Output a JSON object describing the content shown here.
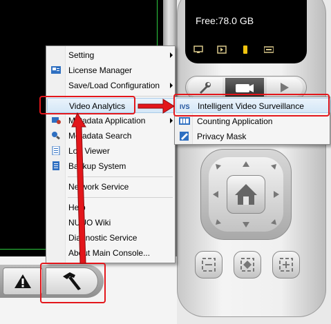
{
  "storage": {
    "free_label": "Free:78.0 GB"
  },
  "screen_icons": [
    "monitor-icon",
    "speaker-icon",
    "phone-icon",
    "keyboard-icon"
  ],
  "device_tabs": [
    {
      "name": "settings",
      "icon": "wrench-icon",
      "active": false
    },
    {
      "name": "camera",
      "icon": "camera-icon",
      "active": true
    },
    {
      "name": "playback",
      "icon": "play-icon",
      "active": false
    }
  ],
  "main_menu": {
    "items": [
      {
        "label": "Setting",
        "icon": "",
        "submenu": true
      },
      {
        "label": "License Manager",
        "icon": "license-icon",
        "submenu": false
      },
      {
        "label": "Save/Load Configuration",
        "icon": "",
        "submenu": true
      },
      {
        "label": "Video Analytics",
        "icon": "",
        "submenu": true,
        "highlighted": true
      },
      {
        "label": "Metadata Application",
        "icon": "metadata-app-icon",
        "submenu": true
      },
      {
        "label": "Metadata Search",
        "icon": "metadata-search-icon",
        "submenu": false
      },
      {
        "label": "Log Viewer",
        "icon": "log-viewer-icon",
        "submenu": false
      },
      {
        "label": "Backup System",
        "icon": "backup-icon",
        "submenu": false
      },
      {
        "label": "Network Service",
        "icon": "",
        "submenu": false
      },
      {
        "label": "Help",
        "icon": "",
        "submenu": false
      },
      {
        "label": "NUUO Wiki",
        "icon": "",
        "submenu": false
      },
      {
        "label": "Diagnostic Service",
        "icon": "",
        "submenu": false
      },
      {
        "label": "About Main Console...",
        "icon": "",
        "submenu": false
      }
    ]
  },
  "sub_menu": {
    "items": [
      {
        "label": "Intelligent Video Surveillance",
        "icon": "ivs-icon",
        "badge": "IVS",
        "highlighted": true
      },
      {
        "label": "Counting Application",
        "icon": "counting-icon",
        "highlighted": false
      },
      {
        "label": "Privacy Mask",
        "icon": "privacy-mask-icon",
        "highlighted": false
      }
    ]
  },
  "bottom_buttons": [
    {
      "name": "alert",
      "icon": "warning-icon"
    },
    {
      "name": "tools",
      "icon": "hammer-icon"
    }
  ],
  "colors": {
    "annotation_red": "#e3161b",
    "video_border_green": "#2ecc40",
    "menu_highlight": "#d4e7f7"
  }
}
